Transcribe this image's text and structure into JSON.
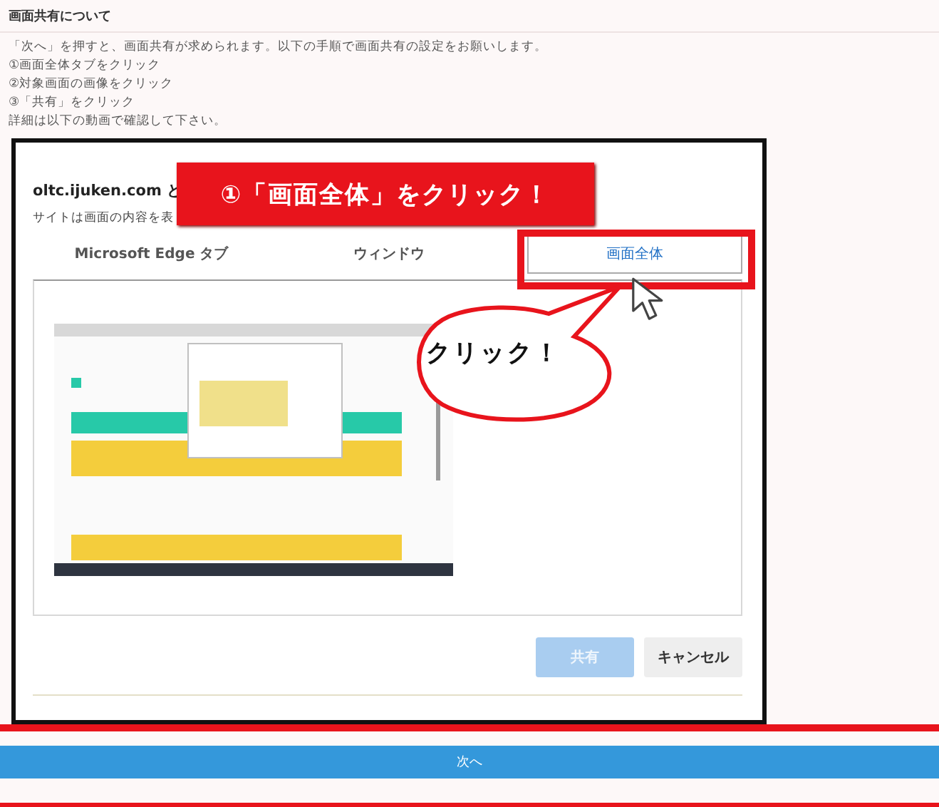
{
  "header": {
    "title": "画面共有について"
  },
  "instructions": [
    "「次へ」を押すと、画面共有が求められます。以下の手順で画面共有の設定をお願いします。",
    "①画面全体タブをクリック",
    "②対象画面の画像をクリック",
    "③「共有」をクリック",
    "詳細は以下の動画で確認して下さい。"
  ],
  "dialog": {
    "title": "oltc.ijuken.com と",
    "subtitle": "サイトは画面の内容を表",
    "tabs": [
      {
        "label": "Microsoft Edge タブ",
        "selected": false
      },
      {
        "label": "ウィンドウ",
        "selected": false
      },
      {
        "label": "画面全体",
        "selected": true
      }
    ],
    "buttons": [
      {
        "label": "共有",
        "disabled": true
      },
      {
        "label": "キャンセル",
        "disabled": false
      }
    ]
  },
  "callout": {
    "text": "①「画面全体」をクリック！"
  },
  "bubble": {
    "text": "クリック！"
  },
  "next_button": {
    "label": "次へ"
  }
}
